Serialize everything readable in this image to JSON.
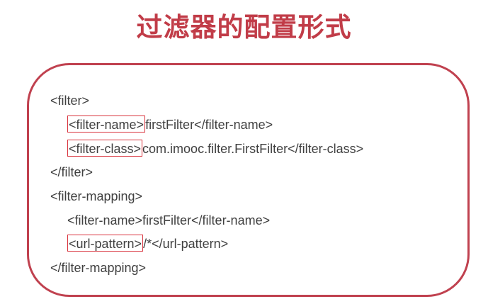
{
  "title": "过滤器的配置形式",
  "colors": {
    "title": "#c13c48",
    "box_border": "#c0414f",
    "highlight_border": "#d9333d",
    "code_text": "#404040"
  },
  "code": {
    "line1": "<filter>",
    "line2": {
      "tag": "<filter-name>",
      "rest": "firstFilter</filter-name>"
    },
    "line3": {
      "tag": "<filter-class>",
      "rest": "com.imooc.filter.FirstFilter</filter-class>"
    },
    "line4": "</filter>",
    "line5": "<filter-mapping>",
    "line6": "<filter-name>firstFilter</filter-name>",
    "line7": {
      "tag": "<url-pattern>",
      "rest": "/*</url-pattern>"
    },
    "line8": "</filter-mapping>"
  }
}
